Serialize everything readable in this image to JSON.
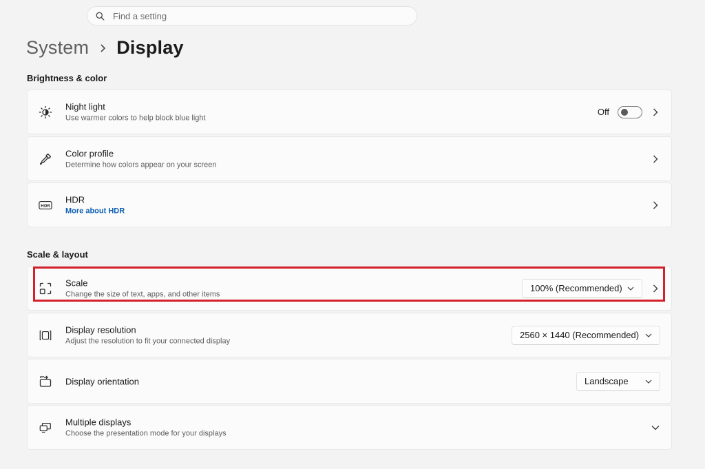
{
  "search": {
    "placeholder": "Find a setting"
  },
  "breadcrumb": {
    "parent": "System",
    "current": "Display"
  },
  "sections": {
    "brightness": "Brightness & color",
    "scale_layout": "Scale & layout"
  },
  "night_light": {
    "title": "Night light",
    "desc": "Use warmer colors to help block blue light",
    "state": "Off"
  },
  "color_profile": {
    "title": "Color profile",
    "desc": "Determine how colors appear on your screen"
  },
  "hdr": {
    "title": "HDR",
    "link": "More about HDR"
  },
  "scale": {
    "title": "Scale",
    "desc": "Change the size of text, apps, and other items",
    "value": "100% (Recommended)"
  },
  "resolution": {
    "title": "Display resolution",
    "desc": "Adjust the resolution to fit your connected display",
    "value": "2560 × 1440 (Recommended)"
  },
  "orientation": {
    "title": "Display orientation",
    "value": "Landscape"
  },
  "multiple": {
    "title": "Multiple displays",
    "desc": "Choose the presentation mode for your displays"
  },
  "colors": {
    "accent_link": "#0e5fb5",
    "highlight": "#d4202a"
  },
  "icons": {
    "search": "search-icon",
    "night_light": "sun-moon-icon",
    "color_profile": "eyedropper-icon",
    "hdr": "hdr-icon",
    "scale": "scale-icon",
    "resolution": "resolution-icon",
    "orientation": "orientation-icon",
    "multiple": "multiple-displays-icon"
  }
}
